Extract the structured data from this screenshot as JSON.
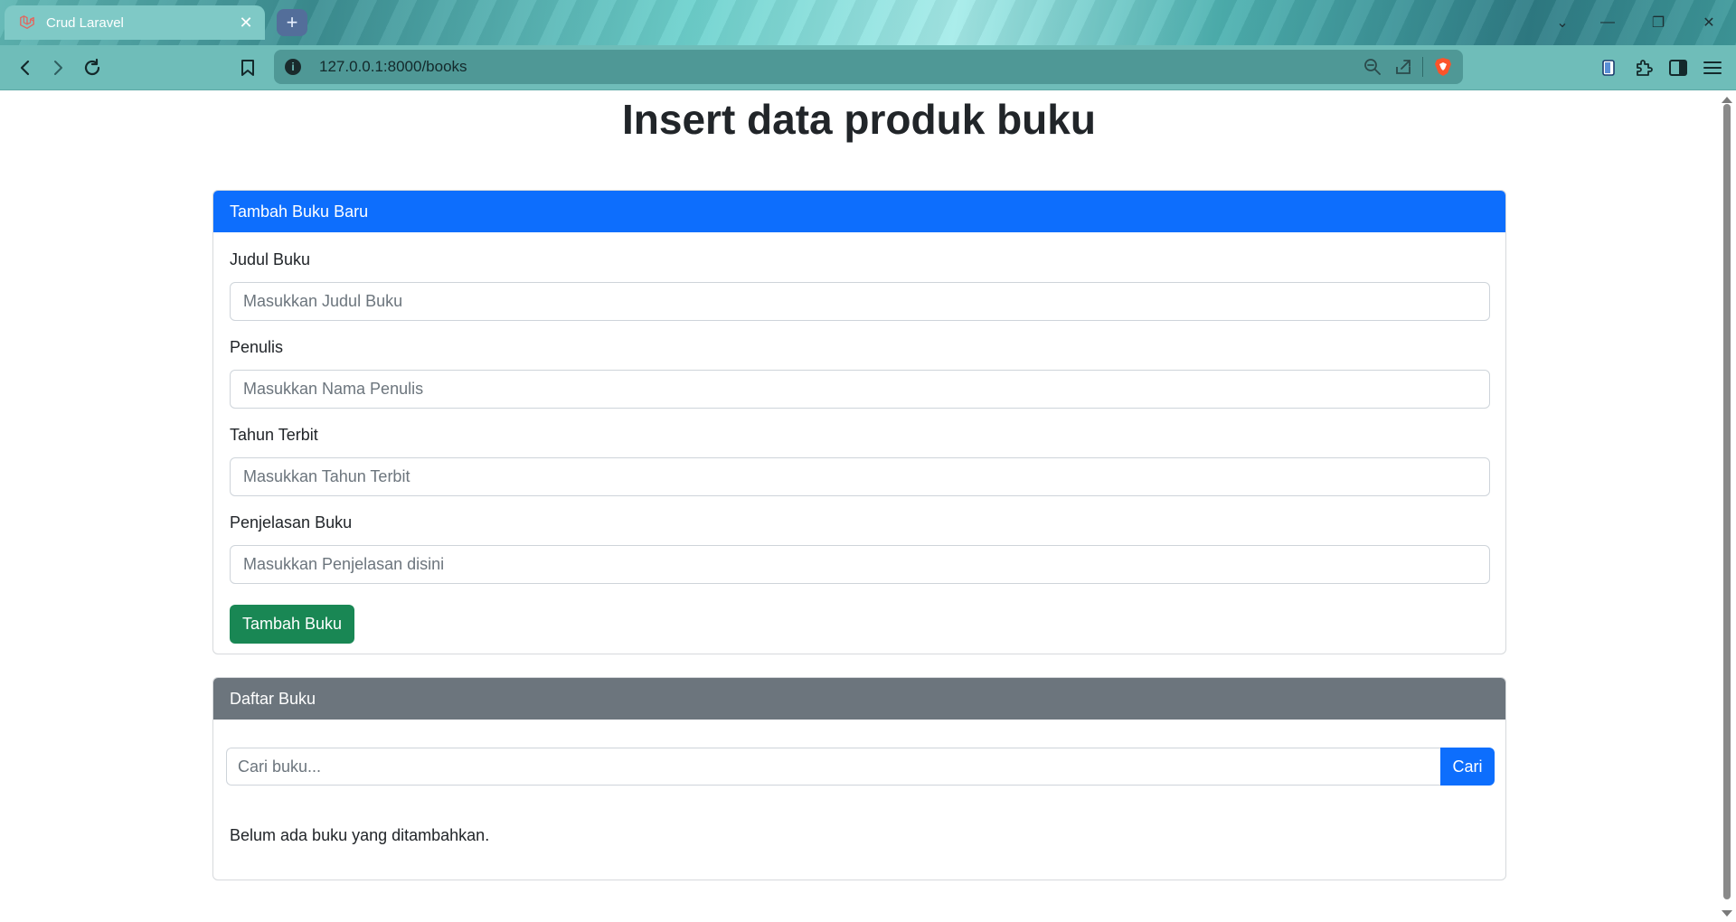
{
  "browser": {
    "tab_title": "Crud Laravel",
    "tab_close": "✕",
    "new_tab": "+",
    "url": "127.0.0.1:8000/books",
    "window_controls": {
      "list": "⌄",
      "minimize": "—",
      "restore": "❐",
      "close": "✕"
    }
  },
  "page": {
    "title": "Insert data produk buku"
  },
  "form_card": {
    "header": "Tambah Buku Baru",
    "fields": [
      {
        "label": "Judul Buku",
        "placeholder": "Masukkan Judul Buku"
      },
      {
        "label": "Penulis",
        "placeholder": "Masukkan Nama Penulis"
      },
      {
        "label": "Tahun Terbit",
        "placeholder": "Masukkan Tahun Terbit"
      },
      {
        "label": "Penjelasan Buku",
        "placeholder": "Masukkan Penjelasan disini"
      }
    ],
    "submit_label": "Tambah Buku"
  },
  "list_card": {
    "header": "Daftar Buku",
    "search_placeholder": "Cari buku...",
    "search_button": "Cari",
    "empty_message": "Belum ada buku yang ditambahkan."
  },
  "colors": {
    "primary": "#0d6efd",
    "success": "#198754",
    "secondary": "#6c757d"
  }
}
